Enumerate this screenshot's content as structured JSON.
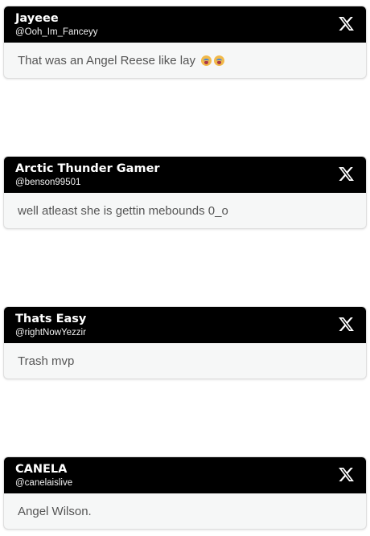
{
  "posts": [
    {
      "display_name": "Jayeee",
      "handle": "@Ooh_Im_Fanceyy",
      "text": "That was an Angel Reese like lay",
      "emojis": [
        "loudly-crying-face",
        "loudly-crying-face"
      ]
    },
    {
      "display_name": "Arctic Thunder Gamer",
      "handle": "@benson99501",
      "text": "well atleast she is gettin mebounds 0_o"
    },
    {
      "display_name": "Thats Easy",
      "handle": "@rightNowYezzir",
      "text": "Trash mvp"
    },
    {
      "display_name": "CANELA",
      "handle": "@canelaislive",
      "text": "Angel Wilson."
    }
  ],
  "icons": {
    "platform_logo": "x-logo-icon"
  },
  "colors": {
    "header_bg": "#000000",
    "body_bg": "#f6f7f7",
    "body_text": "#555555"
  }
}
